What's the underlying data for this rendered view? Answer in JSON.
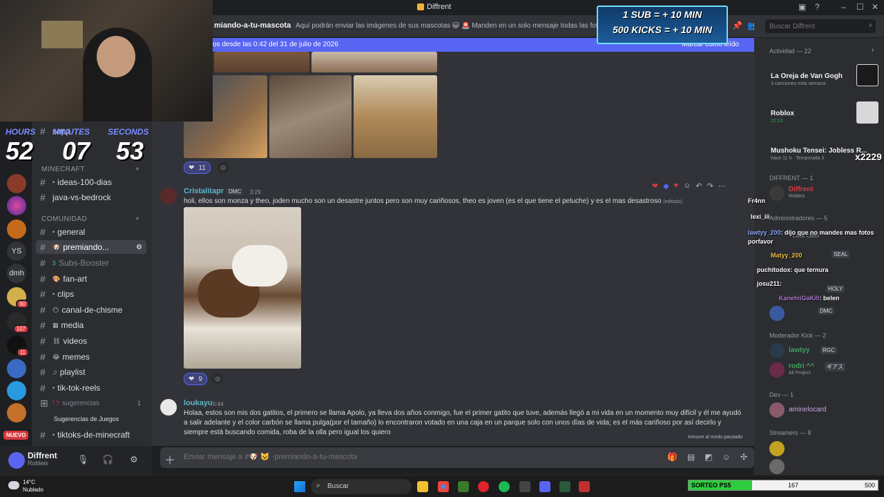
{
  "window": {
    "title": "Diffrent"
  },
  "kick_overlay": {
    "line1": "1 SUB = + 10 MIN",
    "line2": "500 KICKS = + 10 MIN"
  },
  "timer": {
    "hours_label": "HOURS",
    "minutes_label": "MINUTES",
    "seconds_label": "SECONDS",
    "hours": "52",
    "minutes": "07",
    "seconds": "53"
  },
  "channel_header": {
    "name": "miando-a-tu-mascota",
    "topic": "Aquí podrán enviar las imágenes de sus mascotas 😺 🚨 Manden en un solo mensaje todas las fotos de s"
  },
  "new_banner": {
    "text": "os desde las 0:42 del 31 de julio de 2026",
    "mark_read": "Marcar como leído"
  },
  "sidebar": {
    "partial_channel": "sapp",
    "categories": [
      {
        "label": "MINECRAFT"
      },
      {
        "label": "COMUNIDAD"
      }
    ],
    "channels": [
      {
        "label": "ideas-100-dias"
      },
      {
        "label": "java-vs-bedrock"
      },
      {
        "label": "general"
      },
      {
        "label": "premiando..."
      },
      {
        "label": "Subs-Booster"
      },
      {
        "label": "fan-art"
      },
      {
        "label": "clips"
      },
      {
        "label": "canal-de-chisme"
      },
      {
        "label": "media"
      },
      {
        "label": "videos"
      },
      {
        "label": "memes"
      },
      {
        "label": "playlist"
      },
      {
        "label": "tik-tok-reels"
      },
      {
        "label": "sugerencias",
        "count": "1"
      },
      {
        "label": "Sugerencias de Juegos"
      },
      {
        "label": "tiktoks-de-minecraft"
      }
    ]
  },
  "server_rail": {
    "ys": "YS",
    "dmh": "dmh",
    "badges": [
      "90",
      "107",
      "11"
    ],
    "nuevo": "NUEVO"
  },
  "user_panel": {
    "name": "Diffrent",
    "status": "Robleis"
  },
  "messages": [
    {
      "reaction_count": "11"
    },
    {
      "author": "Cristalitapr",
      "tag": "DMC",
      "time": "3:29",
      "text": "holi, ellos son monza y theo, joden mucho son un desastre juntos pero son muy cariñosos, theo es joven (es el que tiene el peluche) y es el mas desastroso",
      "edited": "(editado)",
      "reaction_count": "9"
    },
    {
      "author": "loukayu",
      "time": "5:44",
      "text": "Holaa, estos son mis dos gatitos, el primero se llama Apolo, ya lleva dos años conmigo, fue el primer gatito que tuve, además llegó a mi vida en un momento muy difícil y él me ayudó a salir adelante y el color carbón se llama pulga(por el tamaño) lo encontraron votado en una caja en un parque solo con unos días de vida; es el más cariñoso por así decirlo y siempre está buscando comida, roba de la olla pero igual los quiero"
    }
  ],
  "slowmode": "Inmune al modo pausado",
  "composer": {
    "placeholder": "Enviar mensaje a #🐶 😺 ·premiando-a-tu-mascota"
  },
  "search": {
    "placeholder": "Buscar Diffrent"
  },
  "members": {
    "activity_label": "Actividad — 22",
    "activity": [
      {
        "title": "La Oreja de Van Gogh",
        "sub": "3 canciones esta semana"
      },
      {
        "title": "Roblox",
        "sub": "12:13"
      },
      {
        "title": "Mushoku Tensei: Jobless R...",
        "sub": "hace 11 h · Temporada 3"
      }
    ],
    "count_badge": "x2229",
    "diffrent_label": "DIFFRENT — 1",
    "diffrent_member": {
      "name": "Diffrent",
      "sub": "Robleis"
    },
    "admins_label": "Administradores — 5",
    "admin_sub": "Lunar Client",
    "admin_tags": [
      "SEAL",
      "HOLY",
      "DMC"
    ],
    "mods_label": "Moderador Kick — 2",
    "mods": [
      {
        "name": "lawtyy",
        "tag": "RGC"
      },
      {
        "name": "rodri ^^",
        "tag": "ギアス",
        "sub": "Ali Project"
      }
    ],
    "dev_label": "Dev — 1",
    "dev": {
      "name": "aminelocard"
    },
    "streamers_label": "Streamers — 8"
  },
  "kick_chat": [
    {
      "user": "Fr4nn",
      "text": ""
    },
    {
      "user": "lexi_iii",
      "text": ""
    },
    {
      "user": "lawtyy_200",
      "text": ": dijo que no mandes mas fotos porfavor"
    },
    {
      "user": "Matyy_200",
      "text": ""
    },
    {
      "user": "puchitodox",
      "text": ": que ternura"
    },
    {
      "user": "josu211",
      "text": ":"
    },
    {
      "user": "KanehiiGaKill",
      "text": ": belen"
    }
  ],
  "taskbar": {
    "temp": "14°C",
    "weather": "Nublado",
    "search": "Buscar"
  },
  "sorteo": {
    "label": "SORTEO PS5",
    "value": "167",
    "max": "500",
    "progress": 0.334
  },
  "colors": {
    "accent": "#5865f2",
    "bg": "#313338",
    "sidebar": "#2b2d31",
    "danger": "#da373c"
  }
}
